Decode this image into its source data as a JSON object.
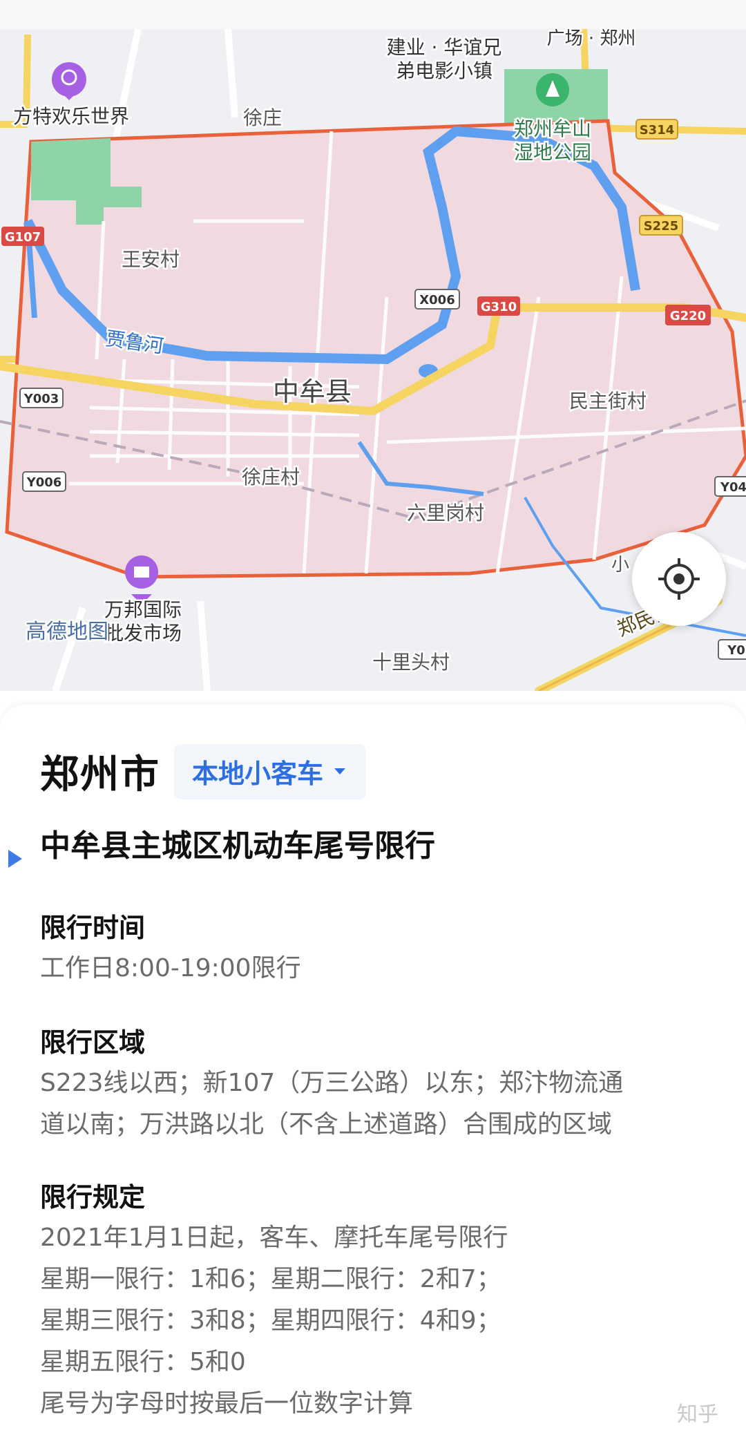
{
  "map": {
    "county": "中牟县",
    "provider_logo": "高德地图",
    "labels": {
      "fangte": "方特欢乐世界",
      "xuzhuang": "徐庄",
      "jianye1": "建业 · 华谊兄",
      "jianye2": "弟电影小镇",
      "guangchang": "广场 · 郑州",
      "moushan1": "郑州牟山",
      "moushan2": "湿地公园",
      "wanganicun": "王安村",
      "jialuhe": "贾鲁河",
      "minzhujie": "民主街村",
      "xuzhuangcun": "徐庄村",
      "liuligang": "六里岗村",
      "wanbang1": "万邦国际",
      "wanbang2": "批发市场",
      "shilitou": "十里头村",
      "zhengmin": "郑民高速",
      "xiao": "小"
    },
    "shields": {
      "s314": "S314",
      "g107": "G107",
      "s225": "S225",
      "x006": "X006",
      "g310": "G310",
      "g220": "G220",
      "y003": "Y003",
      "y006": "Y006",
      "y04": "Y04",
      "y0": "Y0"
    },
    "colors": {
      "zone_fill": "#f1dadf",
      "zone_border": "#e8613b",
      "water": "#5f9ff0",
      "green": "#8fd3a8",
      "shield_red": "#d94a45",
      "shield_yellow": "#f6d461"
    }
  },
  "locate_icon": "crosshair-locate-icon",
  "panel": {
    "city": "郑州市",
    "vehicle_type": "本地小客车",
    "title": "中牟县主城区机动车尾号限行",
    "sections": [
      {
        "heading": "限行时间",
        "lines": [
          "工作日8:00-19:00限行"
        ]
      },
      {
        "heading": "限行区域",
        "lines": [
          "S223线以西；新107（万三公路）以东；郑汴物流通",
          "道以南；万洪路以北（不含上述道路）合围成的区域"
        ]
      },
      {
        "heading": "限行规定",
        "lines": [
          "2021年1月1日起，客车、摩托车尾号限行",
          "星期一限行：1和6；星期二限行：2和7；",
          "星期三限行：3和8；星期四限行：4和9；",
          "星期五限行：5和0",
          "尾号为字母时按最后一位数字计算"
        ]
      }
    ],
    "watermark": "知乎"
  }
}
